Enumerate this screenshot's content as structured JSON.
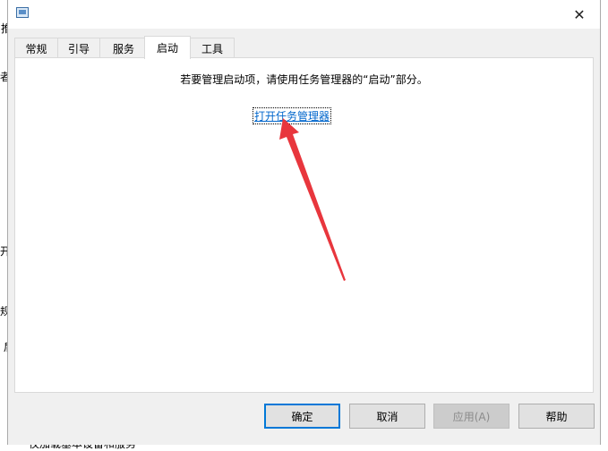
{
  "background": {
    "frag1": "推",
    "frag2": "者",
    "frag3": "\\",
    "frag4": "开",
    "frag5": "规",
    "frag6": "后",
    "bottom_text": "仅加载基本设备和服务"
  },
  "tabs": [
    {
      "label": "常规"
    },
    {
      "label": "引导"
    },
    {
      "label": "服务"
    },
    {
      "label": "启动"
    },
    {
      "label": "工具"
    }
  ],
  "panel": {
    "message": "若要管理启动项，请使用任务管理器的“启动”部分。",
    "link": "打开任务管理器"
  },
  "buttons": {
    "ok": "确定",
    "cancel": "取消",
    "apply": "应用(A)",
    "help": "帮助"
  },
  "close_glyph": "✕",
  "colors": {
    "accent": "#0078d7",
    "link": "#0066cc",
    "arrow": "#e8363d"
  }
}
